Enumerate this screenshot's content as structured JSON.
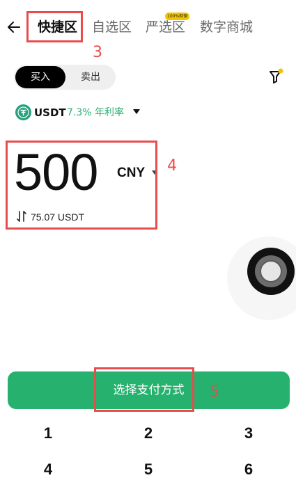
{
  "header": {
    "tabs": [
      {
        "label": "快捷区"
      },
      {
        "label": "自选区"
      },
      {
        "label": "严选区",
        "badge": "100%担保"
      },
      {
        "label": "数字商城"
      }
    ]
  },
  "annotations": [
    "3",
    "4",
    "5"
  ],
  "trade_toggle": {
    "buy": "买入",
    "sell": "卖出"
  },
  "coin": {
    "name": "USDT",
    "rate": "7.3% 年利率"
  },
  "amount": {
    "value": "500",
    "currency": "CNY",
    "converted": "75.07 USDT"
  },
  "pay_button": "选择支付方式",
  "keypad": {
    "row1": [
      "1",
      "2",
      "3"
    ],
    "row2": [
      "4",
      "5",
      "6"
    ]
  },
  "colors": {
    "accent": "#27b16f",
    "annotation": "#e84d4d",
    "badge": "#f2c400"
  }
}
